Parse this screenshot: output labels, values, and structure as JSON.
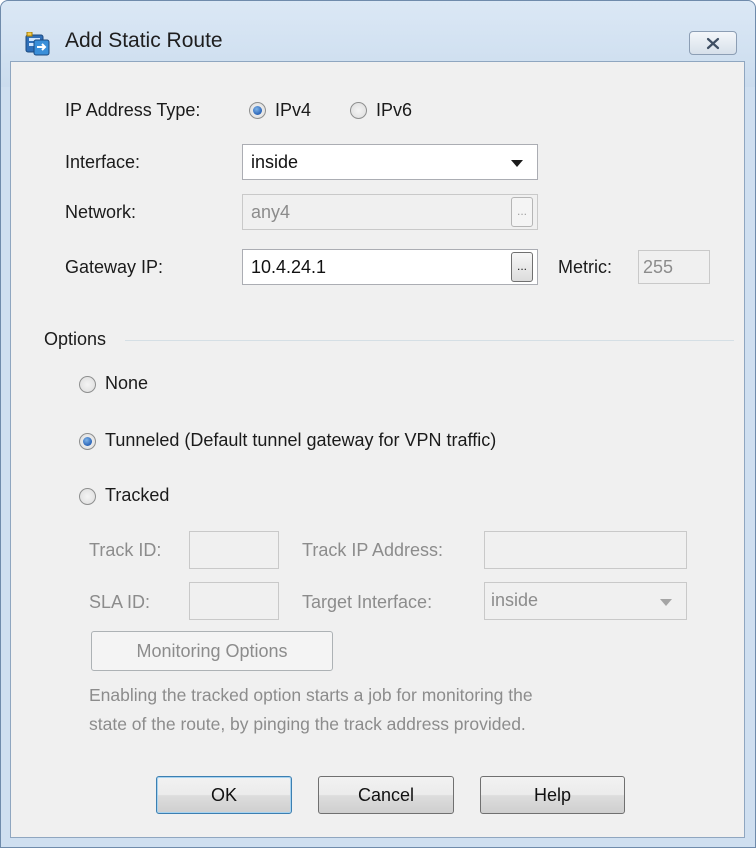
{
  "dialog": {
    "title": "Add Static Route",
    "icon": "static-route-icon",
    "close_icon": "close-icon"
  },
  "ip_type": {
    "label": "IP Address Type:",
    "options": [
      "IPv4",
      "IPv6"
    ],
    "selected": "IPv4"
  },
  "interface": {
    "label": "Interface:",
    "value": "inside"
  },
  "network": {
    "label": "Network:",
    "value": "any4",
    "browse_label": "..."
  },
  "gateway": {
    "label": "Gateway IP:",
    "value": "10.4.24.1",
    "browse_label": "..."
  },
  "metric": {
    "label": "Metric:",
    "value": "255"
  },
  "options": {
    "title": "Options",
    "none_label": "None",
    "tunneled_label": "Tunneled (Default tunnel gateway for VPN traffic)",
    "tracked_label": "Tracked",
    "selected": "Tunneled"
  },
  "tracked": {
    "track_id_label": "Track ID:",
    "track_id_value": "",
    "track_ip_label": "Track IP Address:",
    "track_ip_value": "",
    "sla_id_label": "SLA ID:",
    "sla_id_value": "",
    "target_interface_label": "Target Interface:",
    "target_interface_value": "inside",
    "monitoring_button": "Monitoring Options",
    "help_line1": "Enabling the tracked option starts a job for monitoring the",
    "help_line2": "state of the route, by pinging the track address provided."
  },
  "buttons": {
    "ok": "OK",
    "cancel": "Cancel",
    "help": "Help"
  }
}
